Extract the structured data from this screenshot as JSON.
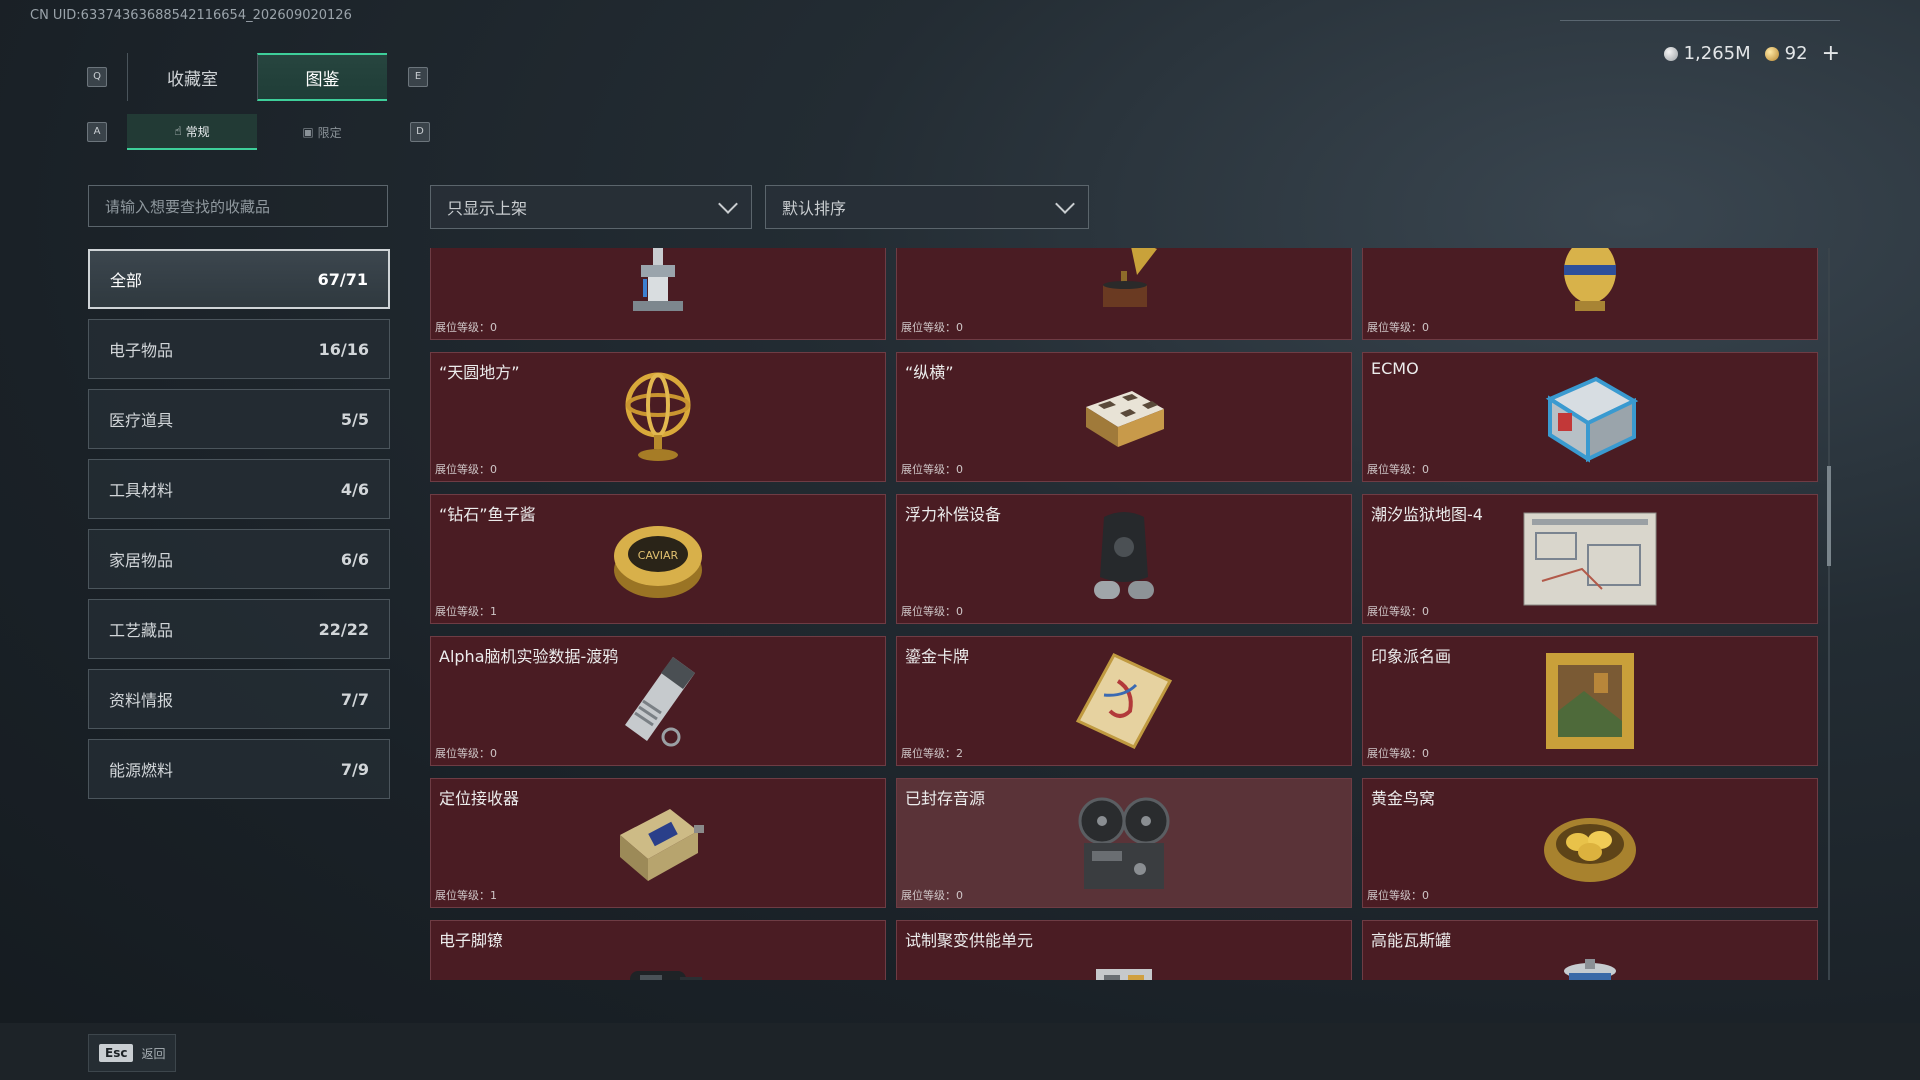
{
  "uid": "CN UID:63374363688542116654_202609020126",
  "keys": {
    "q": "Q",
    "e": "E",
    "a": "A",
    "d": "D"
  },
  "tabs_main": [
    {
      "label": "收藏室",
      "active": false
    },
    {
      "label": "图鉴",
      "active": true
    }
  ],
  "tabs_sub": [
    {
      "label": "常规",
      "active": true
    },
    {
      "label": "限定",
      "active": false
    }
  ],
  "currency": {
    "silver": "1,265M",
    "gold": "92",
    "plus": "+"
  },
  "search": {
    "placeholder": "请输入想要查找的收藏品"
  },
  "categories": [
    {
      "label": "全部",
      "count": "67/71",
      "active": true
    },
    {
      "label": "电子物品",
      "count": "16/16"
    },
    {
      "label": "医疗道具",
      "count": "5/5"
    },
    {
      "label": "工具材料",
      "count": "4/6"
    },
    {
      "label": "家居物品",
      "count": "6/6"
    },
    {
      "label": "工艺藏品",
      "count": "22/22"
    },
    {
      "label": "资料情报",
      "count": "7/7"
    },
    {
      "label": "能源燃料",
      "count": "7/9"
    }
  ],
  "filters": {
    "shelf": "只显示上架",
    "sort": "默认排序"
  },
  "items": [
    {
      "name": "",
      "level": "展位等级：0",
      "icon": "robot-arm-icon"
    },
    {
      "name": "",
      "level": "展位等级：0",
      "icon": "gramophone-icon"
    },
    {
      "name": "",
      "level": "展位等级：0",
      "icon": "golden-egg-icon"
    },
    {
      "name": "“天圆地方”",
      "level": "展位等级：0",
      "icon": "armillary-sphere-icon"
    },
    {
      "name": "“纵横”",
      "level": "展位等级：0",
      "icon": "chessboard-icon"
    },
    {
      "name": "ECMO",
      "level": "展位等级：0",
      "icon": "ecmo-machine-icon"
    },
    {
      "name": "“钻石”鱼子酱",
      "level": "展位等级：1",
      "icon": "caviar-tin-icon"
    },
    {
      "name": "浮力补偿设备",
      "level": "展位等级：0",
      "icon": "buoyancy-device-icon"
    },
    {
      "name": "潮汐监狱地图-4",
      "level": "展位等级：0",
      "icon": "map-icon"
    },
    {
      "name": "Alpha脑机实验数据-渡鸦",
      "level": "展位等级：0",
      "icon": "data-drive-icon"
    },
    {
      "name": "鎏金卡牌",
      "level": "展位等级：2",
      "icon": "gilded-card-icon"
    },
    {
      "name": "印象派名画",
      "level": "展位等级：0",
      "icon": "painting-icon"
    },
    {
      "name": "定位接收器",
      "level": "展位等级：1",
      "icon": "gps-receiver-icon"
    },
    {
      "name": "已封存音源",
      "level": "展位等级：0",
      "icon": "reel-recorder-icon",
      "sealed": true
    },
    {
      "name": "黄金鸟窝",
      "level": "展位等级：0",
      "icon": "golden-nest-icon"
    },
    {
      "name": "电子脚镣",
      "level": "",
      "icon": "ankle-monitor-icon"
    },
    {
      "name": "试制聚变供能单元",
      "level": "",
      "icon": "fusion-unit-icon"
    },
    {
      "name": "高能瓦斯罐",
      "level": "",
      "icon": "gas-canister-icon"
    }
  ],
  "footer": {
    "esc_key": "Esc",
    "esc_label": "返回"
  },
  "colors": {
    "accent": "#3ecf9a",
    "card_bg": "#4a1c23",
    "card_sealed": "#5a3338"
  }
}
